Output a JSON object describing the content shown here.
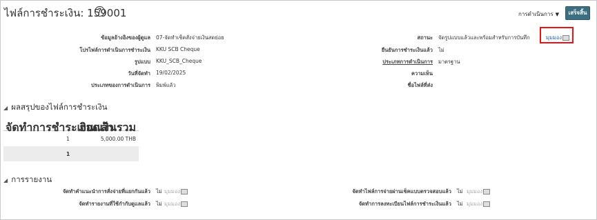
{
  "page": {
    "title": "ไฟล์การชำระเงิน: 159001",
    "help_icon": "?"
  },
  "header": {
    "actions_label": "การดำเนินการ",
    "actions_caret": "▼",
    "done_label": "เสร็จสิ้น"
  },
  "details": {
    "left": [
      {
        "label": "ข้อมูลอ้างอิงของผู้ดูแล",
        "value": "07-จัดทำเช็คสั่งจ่ายเงินสดย่อย"
      },
      {
        "label": "โปรไฟล์การดำเนินการชำระเงิน",
        "value": "KKU SCB Cheque"
      },
      {
        "label": "รูปแบบ",
        "value": "KKU_SCB_Cheque"
      },
      {
        "label": "วันที่จัดทำ",
        "value": "19/02/2025"
      },
      {
        "label": "ประเภทของการดำเนินการ",
        "value": "พิมพ์แล้ว"
      }
    ],
    "right": {
      "status_label": "สถานะ",
      "status_value": "จัดรูปแบบแล้วและพร้อมสำหรับการบันทึก",
      "status_link": "มุมมอง",
      "confirmed_label": "ยืนยันการชำระเงินแล้ว",
      "confirmed_value": "ไม่",
      "process_type_label": "ประเภทการดำเนินการ",
      "process_type_value": "มาตรฐาน",
      "comment_label": "ความเห็น",
      "filename_label": "ชื่อไฟล์ที่ส่ง"
    }
  },
  "summary": {
    "title": "ผลสรุปของไฟล์การชำระเงิน",
    "columns": [
      "จัดทำการชำระเงินแล้ว",
      "ยอดเงินรวม"
    ],
    "rows": [
      {
        "count": "1",
        "amount": "5,000.00 THB"
      }
    ],
    "total_count": "1"
  },
  "reporting": {
    "title": "การรายงาน",
    "items": [
      {
        "label": "จัดทำคำแนะนำการสั่งจ่ายที่แยกกันแล้ว",
        "value": "ไม่",
        "link": "มุมมอง"
      },
      {
        "label": "จัดทำรายงานที่ใช้กำกับดูแลแล้ว",
        "value": "ไม่",
        "link": "มุมมอง"
      },
      {
        "label": "จัดทำไฟล์การจ่ายผ่านเช็คแบบตรวจสอบแล้ว",
        "value": "ไม่",
        "link": "มุมมอง"
      },
      {
        "label": "จัดทำการลงทะเบียนไฟล์การชำระเงินแล้ว",
        "value": "ไม่",
        "link": "มุมมอง"
      }
    ]
  },
  "colors": {
    "done_button": "#3a6e80",
    "link": "#1a5fa6",
    "highlight": "#e11111"
  }
}
